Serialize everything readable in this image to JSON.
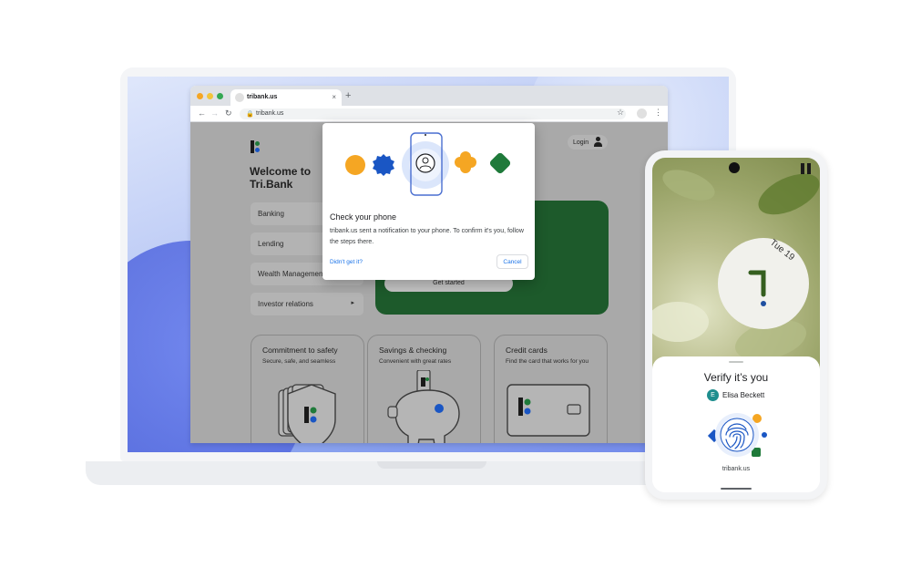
{
  "browser": {
    "tab_title": "tribank.us",
    "tab_close": "×",
    "new_tab": "+",
    "address": "tribank.us",
    "nav_back": "←",
    "nav_forward": "→",
    "nav_reload": "↻",
    "lock": "🔒",
    "bookmark": "☆",
    "menu": "⋮"
  },
  "page": {
    "welcome": "Welcome to Tri.Bank",
    "login_label": "Login",
    "menu": [
      {
        "label": "Banking"
      },
      {
        "label": "Lending"
      },
      {
        "label": "Wealth Management"
      },
      {
        "label": "Investor relations",
        "arrow": "▸"
      }
    ],
    "get_started": "Get started",
    "cards": [
      {
        "title": "Commitment to safety",
        "subtitle": "Secure, safe, and seamless"
      },
      {
        "title": "Savings & checking",
        "subtitle": "Convenient with great rates"
      },
      {
        "title": "Credit cards",
        "subtitle": "Find the card that works for you"
      }
    ]
  },
  "dialog": {
    "title": "Check your phone",
    "body": "tribank.us sent a notification to your phone. To confirm it's you, follow the steps there.",
    "help_link": "Didn't get it?",
    "cancel": "Cancel"
  },
  "phone": {
    "date": "Tue 19",
    "prompt": "Verify it’s you",
    "account_initial": "E",
    "account_name": "Elisa Beckett",
    "domain": "tribank.us"
  },
  "colors": {
    "orange": "#f5a623",
    "blue": "#1a56c4",
    "green": "#1f7a3a",
    "link": "#1a73e8",
    "promo_green": "#1d5a2b"
  }
}
